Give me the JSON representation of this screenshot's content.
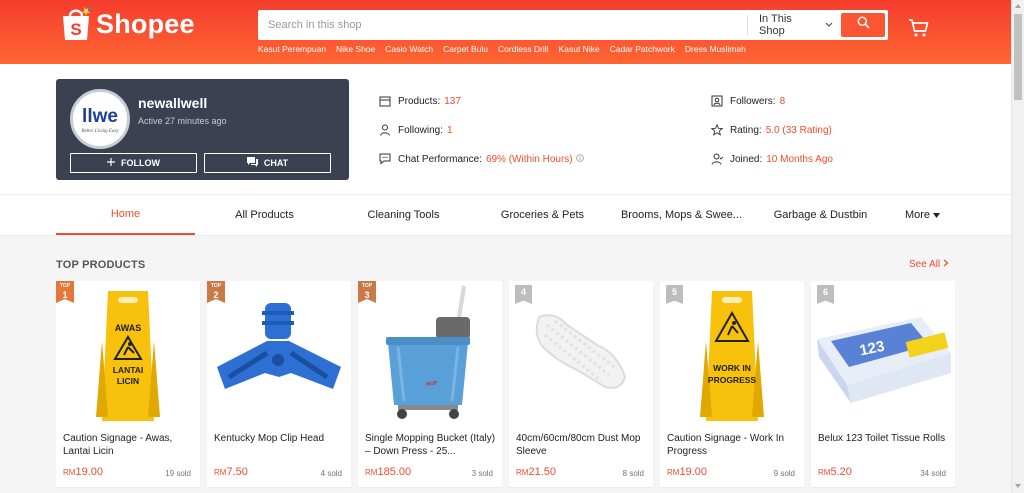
{
  "header": {
    "logo_text": "Shopee",
    "search": {
      "placeholder": "Search in this shop",
      "scope": "In This Shop"
    },
    "keywords": [
      "Kasut Perempuan",
      "Nike Shoe",
      "Casio Watch",
      "Carpet Bulu",
      "Cordless Drill",
      "Kasut Nike",
      "Cadar Patchwork",
      "Dress Muslimah"
    ]
  },
  "shop": {
    "logo_text": "llwe",
    "logo_tagline": "Better Living Easy",
    "name": "newallwell",
    "active": "Active 27 minutes ago",
    "follow_label": "FOLLOW",
    "chat_label": "CHAT",
    "stats": {
      "products": {
        "label": "Products:",
        "value": "137"
      },
      "following": {
        "label": "Following:",
        "value": "1"
      },
      "chat_performance": {
        "label": "Chat Performance:",
        "value": "69% (Within Hours)"
      },
      "followers": {
        "label": "Followers:",
        "value": "8"
      },
      "rating": {
        "label": "Rating:",
        "value": "5.0 (33 Rating)"
      },
      "joined": {
        "label": "Joined:",
        "value": "10 Months Ago"
      }
    }
  },
  "tabs": [
    "Home",
    "All Products",
    "Cleaning Tools",
    "Groceries & Pets",
    "Brooms, Mops & Swee...",
    "Garbage & Dustbin",
    "More"
  ],
  "active_tab": "Home",
  "top_products": {
    "title": "TOP PRODUCTS",
    "see_all": "See All",
    "top_badge": "TOP",
    "items": [
      {
        "rank": "1",
        "name": "Caution Signage - Awas, Lantai Licin",
        "currency": "RM",
        "price": "19.00",
        "sold": "19 sold",
        "sign_text": [
          "AWAS",
          "LANTAI",
          "LICIN"
        ]
      },
      {
        "rank": "2",
        "name": "Kentucky Mop Clip Head",
        "currency": "RM",
        "price": "7.50",
        "sold": "4 sold"
      },
      {
        "rank": "3",
        "name": "Single Mopping Bucket (Italy) – Down Press - 25...",
        "currency": "RM",
        "price": "185.00",
        "sold": "3 sold"
      },
      {
        "rank": "4",
        "name": "40cm/60cm/80cm Dust Mop Sleeve",
        "currency": "RM",
        "price": "21.50",
        "sold": "8 sold"
      },
      {
        "rank": "5",
        "name": "Caution Signage - Work In Progress",
        "currency": "RM",
        "price": "19.00",
        "sold": "9 sold",
        "sign_text": [
          "WORK IN",
          "PROGRESS"
        ]
      },
      {
        "rank": "6",
        "name": "Belux 123 Toilet Tissue Rolls",
        "currency": "RM",
        "price": "5.20",
        "sold": "34 sold",
        "pack_text": "123"
      }
    ]
  },
  "colors": {
    "brand": "#ee4d2d",
    "header_top": "#f53d2d",
    "header_bottom": "#ff6633",
    "shop_card": "#3c4152",
    "rank_top": "#e5773a",
    "rank_bronze": "#c97a46",
    "rank_gray": "#bdbdbd"
  }
}
